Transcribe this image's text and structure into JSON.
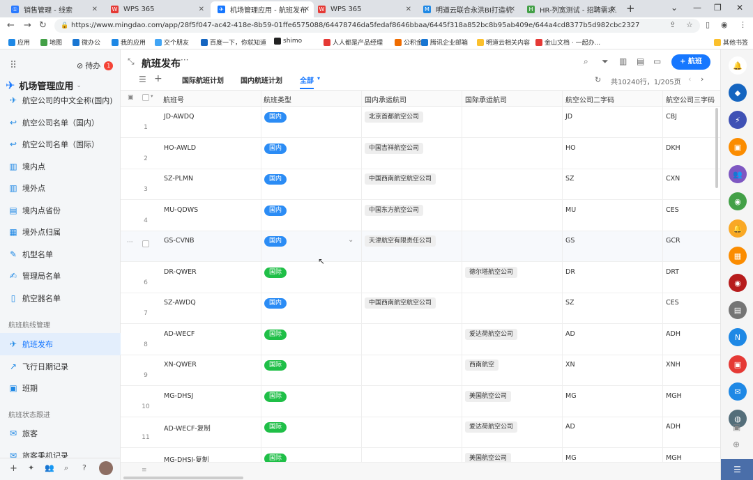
{
  "browser": {
    "tabs": [
      {
        "title": "销售管理 - 线索",
        "color": "#2979ff",
        "glyph": "①"
      },
      {
        "title": "WPS 365",
        "color": "#e53935",
        "glyph": "W"
      },
      {
        "title": "机场管理应用 - 航班发布",
        "color": "#1677ff",
        "glyph": "✈"
      },
      {
        "title": "WPS 365",
        "color": "#e53935",
        "glyph": "W"
      },
      {
        "title": "明道云联合永洪BI打造机...",
        "color": "#1e88e5",
        "glyph": "M"
      },
      {
        "title": "HR-列宽测试 - 招聘需求...",
        "color": "#43a047",
        "glyph": "H"
      }
    ],
    "url": "https://www.mingdao.com/app/28f5f047-ac42-418e-8b59-01ffe6575088/64478746da5fedaf8646bbaa/6445f318a852bc8b95ab409e/644a4cd8377b5d982cbc2327",
    "bookmarks": [
      "应用",
      "地图",
      "微办公",
      "我的应用",
      "交个朋友",
      "百度一下，你就知道",
      "shimo",
      "人人都是产品经理",
      "公积金",
      "腾讯企业邮箱",
      "明道云相关内容",
      "金山文档 · 一起办...",
      "其他书签"
    ]
  },
  "sidebar": {
    "todo_label": "待办",
    "todo_count": "1",
    "app_name": "机场管理应用",
    "items": [
      {
        "label": "航空公司的中文全称(国内)",
        "icon": "plane-icon"
      },
      {
        "label": "航空公司名单（国内）",
        "icon": "reply-icon"
      },
      {
        "label": "航空公司名单（国际）",
        "icon": "reply-icon"
      },
      {
        "label": "境内点",
        "icon": "bar-icon"
      },
      {
        "label": "境外点",
        "icon": "bar-icon"
      },
      {
        "label": "境内点省份",
        "icon": "chair-icon"
      },
      {
        "label": "境外点归属",
        "icon": "table-icon"
      },
      {
        "label": "机型名单",
        "icon": "magic-icon"
      },
      {
        "label": "管理局名单",
        "icon": "edit-icon"
      },
      {
        "label": "航空器名单",
        "icon": "device-icon"
      }
    ],
    "section1": "航班航线管理",
    "items2": [
      {
        "label": "航班发布",
        "icon": "plane-icon"
      },
      {
        "label": "飞行日期记录",
        "icon": "chart-icon"
      },
      {
        "label": "班期",
        "icon": "calendar-icon"
      }
    ],
    "section2": "航班状态跟进",
    "items3": [
      {
        "label": "旅客",
        "icon": "inbox-icon"
      },
      {
        "label": "旅客乘机记录",
        "icon": "inbox-icon"
      }
    ]
  },
  "main": {
    "title": "航班发布",
    "add_button": "+ 航班",
    "views": [
      "国际航班计划",
      "国内航班计划",
      "全部"
    ],
    "count": "共10240行，1/205页",
    "columns": [
      "航班号",
      "航班类型",
      "国内承运航司",
      "国际承运航司",
      "航空公司二字码",
      "航空公司三字码"
    ],
    "rows": [
      {
        "idx": "1",
        "no": "JD-AWDQ",
        "type": "国内",
        "dom": "北京首都航空公司",
        "intl": "",
        "c2": "JD",
        "c3": "CBJ"
      },
      {
        "idx": "2",
        "no": "HO-AWLD",
        "type": "国内",
        "dom": "中国吉祥航空公司",
        "intl": "",
        "c2": "HO",
        "c3": "DKH"
      },
      {
        "idx": "3",
        "no": "SZ-PLMN",
        "type": "国内",
        "dom": "中国西南航空航空公司",
        "intl": "",
        "c2": "SZ",
        "c3": "CXN"
      },
      {
        "idx": "4",
        "no": "MU-QDWS",
        "type": "国内",
        "dom": "中国东方航空公司",
        "intl": "",
        "c2": "MU",
        "c3": "CES"
      },
      {
        "idx": "",
        "no": "GS-CVNB",
        "type": "国内",
        "dom": "天津航空有限责任公司",
        "intl": "",
        "c2": "GS",
        "c3": "GCR"
      },
      {
        "idx": "6",
        "no": "DR-QWER",
        "type": "国际",
        "dom": "",
        "intl": "德尔塔航空公司",
        "c2": "DR",
        "c3": "DRT"
      },
      {
        "idx": "7",
        "no": "SZ-AWDQ",
        "type": "国内",
        "dom": "中国西南航空航空公司",
        "intl": "",
        "c2": "SZ",
        "c3": "CES"
      },
      {
        "idx": "8",
        "no": "AD-WECF",
        "type": "国际",
        "dom": "",
        "intl": "爱达荷航空公司",
        "c2": "AD",
        "c3": "ADH"
      },
      {
        "idx": "9",
        "no": "XN-QWER",
        "type": "国际",
        "dom": "",
        "intl": "西南航空",
        "c2": "XN",
        "c3": "XNH"
      },
      {
        "idx": "10",
        "no": "MG-DHSJ",
        "type": "国际",
        "dom": "",
        "intl": "美国航空公司",
        "c2": "MG",
        "c3": "MGH"
      },
      {
        "idx": "11",
        "no": "AD-WECF-复制",
        "type": "国际",
        "dom": "",
        "intl": "爱达荷航空公司",
        "c2": "AD",
        "c3": "ADH"
      },
      {
        "idx": "12",
        "no": "MG-DHSJ-复制",
        "type": "国际",
        "dom": "",
        "intl": "美国航空公司",
        "c2": "MG",
        "c3": "MGH"
      }
    ]
  },
  "colors": {
    "domestic": "#2b8cf5",
    "international": "#1fbf47",
    "accent": "#1677ff"
  }
}
